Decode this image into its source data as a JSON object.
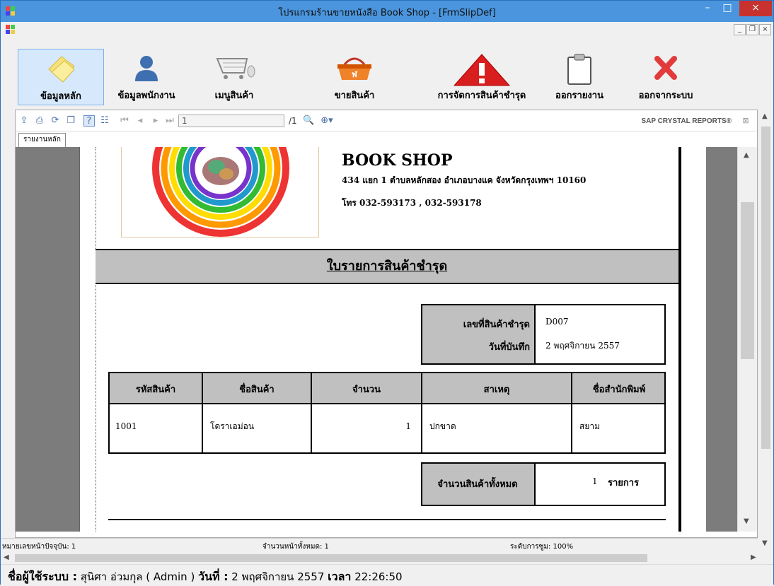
{
  "window": {
    "title": "โปรแกรมร้านขายหนังสือ Book Shop - [FrmSlipDef]",
    "minimize": "–",
    "maximize": "□",
    "close": "×"
  },
  "mdi": {
    "minimize": "_",
    "restore": "❐",
    "close": "×"
  },
  "toolbar": {
    "items": [
      {
        "label": "ข้อมูลหลัก",
        "icon": "notes-icon"
      },
      {
        "label": "ข้อมูลพนักงาน",
        "icon": "user-icon"
      },
      {
        "label": "เมนูสินค้า",
        "icon": "cart-icon"
      },
      {
        "label": "ขายสินค้า",
        "icon": "basket-icon"
      },
      {
        "label": "การจัดการสินค้าชำรุด",
        "icon": "warning-icon"
      },
      {
        "label": "ออกรายงาน",
        "icon": "clipboard-icon"
      },
      {
        "label": "ออกจากระบบ",
        "icon": "close-x-icon"
      }
    ]
  },
  "report_toolbar": {
    "page_input": "1",
    "page_total": "/1",
    "brand": "SAP CRYSTAL REPORTS®",
    "tab": "รายงานหลัก"
  },
  "report": {
    "shop_name": "BOOK SHOP",
    "address": "434 แยก 1 ตำบลหลักสอง อำเภอบางแค จังหวัดกรุงเทพฯ  10160",
    "phone": "โทร 032-593173 , 032-593178",
    "heading": "ใบรายการสินค้าชำรุด",
    "slip_no_label": "เลขที่สินค้าชำรุด",
    "slip_no": "D007",
    "date_label": "วันที่บันทึก",
    "date": "2  พฤศจิกายน  2557",
    "columns": [
      "รหัสสินค้า",
      "ชื่อสินค้า",
      "จำนวน",
      "สาเหตุ",
      "ชื่อสำนักพิมพ์"
    ],
    "rows": [
      {
        "code": "1001",
        "name": "โดราเอม่อน",
        "qty": "1",
        "reason": "ปกขาด",
        "publisher": "สยาม"
      }
    ],
    "total_label": "จำนวนสินค้าทั้งหมด",
    "total_value": "1",
    "total_unit": "รายการ"
  },
  "report_status": {
    "current_page": "หมายเลขหน้าปัจจุบัน: 1",
    "total_pages": "จำนวนหน้าทั้งหมด: 1",
    "zoom": "ระดับการซูม: 100%"
  },
  "status": {
    "user_label": "ชื่อผู้ใช้ระบบ :",
    "user": "สุนิศา อ่วมกุล  ( Admin )",
    "date_label": "วันที่ :",
    "date": "2 พฤศจิกายน 2557",
    "time_label": "เวลา",
    "time": "22:26:50"
  }
}
